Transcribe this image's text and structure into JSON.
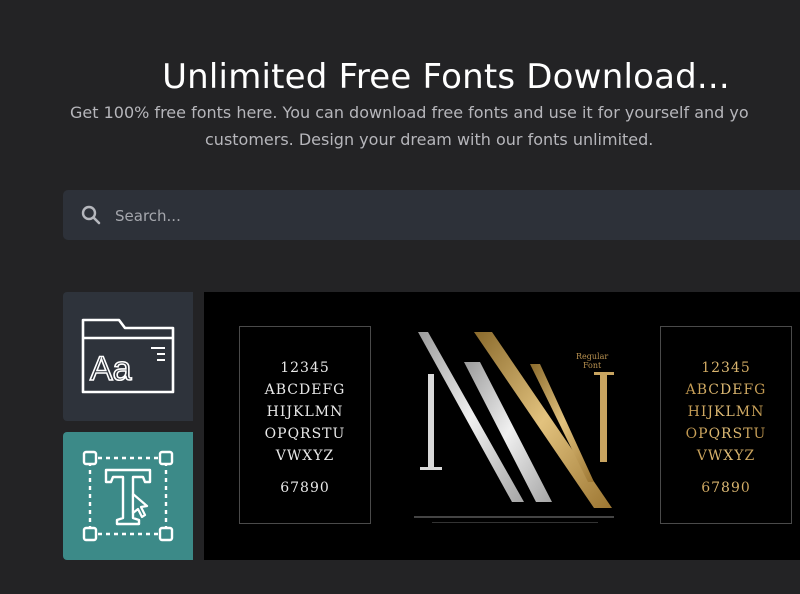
{
  "hero": {
    "title": "Unlimited Free Fonts Download...",
    "subtitle_line1": "Get 100% free fonts here. You can download free fonts and use it for yourself and yo",
    "subtitle_line2": "customers. Design your dream with our fonts unlimited."
  },
  "search": {
    "placeholder": "Search...",
    "icon": "search-icon"
  },
  "sidebar": {
    "tiles": [
      {
        "icon": "font-folder-icon",
        "label": "Aa",
        "bg": "#2e333b"
      },
      {
        "icon": "text-transform-icon",
        "label": "T",
        "bg": "#3c8a88"
      }
    ]
  },
  "preview": {
    "regular_label_1": "Regular",
    "regular_label_2": "Font",
    "card_left": {
      "lines": [
        "12345",
        "ABCDEFG",
        "HIJKLMN",
        "OPQRSTU",
        "VWXYZ",
        "67890"
      ]
    },
    "card_right": {
      "lines": [
        "12345",
        "ABCDEFG",
        "HIJKLMN",
        "OPQRSTU",
        "VWXYZ",
        "67890"
      ]
    }
  },
  "colors": {
    "background": "#232325",
    "search_bg": "#2d3139",
    "teal": "#3c8a88",
    "gold": "#c89b4a"
  }
}
